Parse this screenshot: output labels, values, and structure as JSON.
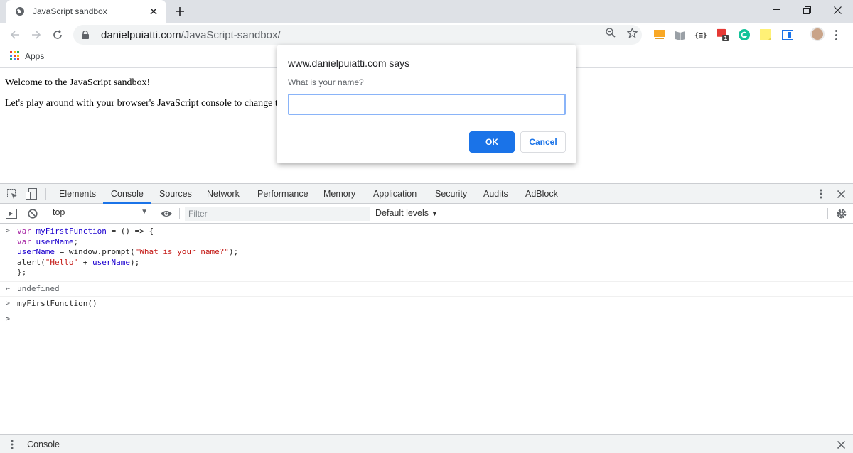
{
  "tab": {
    "title": "JavaScript sandbox"
  },
  "omnibox": {
    "host": "danielpuiatti.com",
    "path": "/JavaScript-sandbox/"
  },
  "bookmarks": {
    "apps_label": "Apps"
  },
  "page": {
    "line1": "Welcome to the JavaScript sandbox!",
    "line2": "Let's play around with your browser's JavaScript console to change the"
  },
  "dialog": {
    "title": "www.danielpuiatti.com says",
    "message": "What is your name?",
    "input_value": "",
    "ok_label": "OK",
    "cancel_label": "Cancel"
  },
  "devtools": {
    "tabs": [
      "Elements",
      "Console",
      "Sources",
      "Network",
      "Performance",
      "Memory",
      "Application",
      "Security",
      "Audits",
      "AdBlock"
    ],
    "active_tab": "Console",
    "context": "top",
    "filter_placeholder": "Filter",
    "levels": "Default levels",
    "drawer_tab": "Console"
  },
  "console": {
    "code_line1_kw": "var",
    "code_line1_id": "myFirstFunction",
    "code_line1_rest": " = () => {",
    "code_line2_kw": "var",
    "code_line2_id": "userName",
    "code_line2_rest": ";",
    "code_line3_id": "userName",
    "code_line3_mid": " = window.prompt(",
    "code_line3_str": "\"What is your name?\"",
    "code_line3_end": ");",
    "code_line4_start": "alert(",
    "code_line4_str": "\"Hello\"",
    "code_line4_mid": " + ",
    "code_line4_id": "userName",
    "code_line4_end": ");",
    "code_line5": "};",
    "result": "undefined",
    "call": "myFirstFunction()"
  },
  "colors": {
    "accent": "#1a73e8",
    "keyword": "#a626a4",
    "string": "#c41a16",
    "identifier": "#1c00cf"
  }
}
